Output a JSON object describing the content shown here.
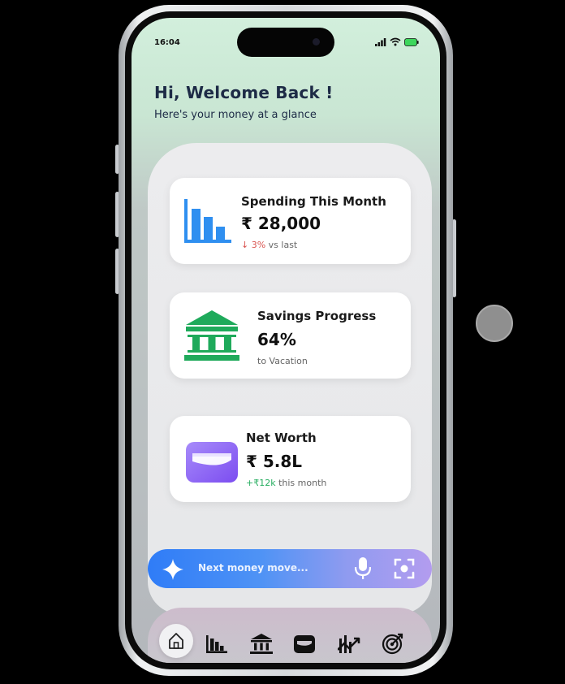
{
  "status_bar": {
    "time": "16:04",
    "icons": [
      "signal-icon",
      "wifi-icon",
      "battery-icon"
    ]
  },
  "header": {
    "greeting": "Hi, Welcome Back !",
    "subtitle": "Here's your money at a glance"
  },
  "cards": {
    "spending": {
      "title": "Spending This Month",
      "value": "₹ 28,000",
      "change": "↓ 3%",
      "change_suffix": " vs last",
      "icon": "bar-chart-icon"
    },
    "savings": {
      "title": "Savings Progress",
      "value": "64%",
      "detail": "to Vacation",
      "icon": "bank-icon"
    },
    "networth": {
      "title": "Net Worth",
      "value": "₹ 5.8L",
      "change": "+₹12k",
      "change_suffix": " this month",
      "icon": "wallet-icon"
    }
  },
  "assistant_bar": {
    "prompt": "Next money move...",
    "icons": [
      "sparkle-icon",
      "microphone-icon",
      "scan-icon"
    ]
  },
  "nav": {
    "items": [
      "home-icon",
      "bar-chart-icon",
      "bank-icon",
      "wallet-icon",
      "trend-icon",
      "target-icon"
    ]
  },
  "colors": {
    "accent_blue": "#2f7cf7",
    "accent_purple": "#b39cef",
    "bank_green": "#1faa5b",
    "wallet_purple": "#8b5cf6",
    "chart_blue": "#2f8ff0",
    "decrease_red": "#d9534f",
    "increase_green": "#27ae60"
  }
}
